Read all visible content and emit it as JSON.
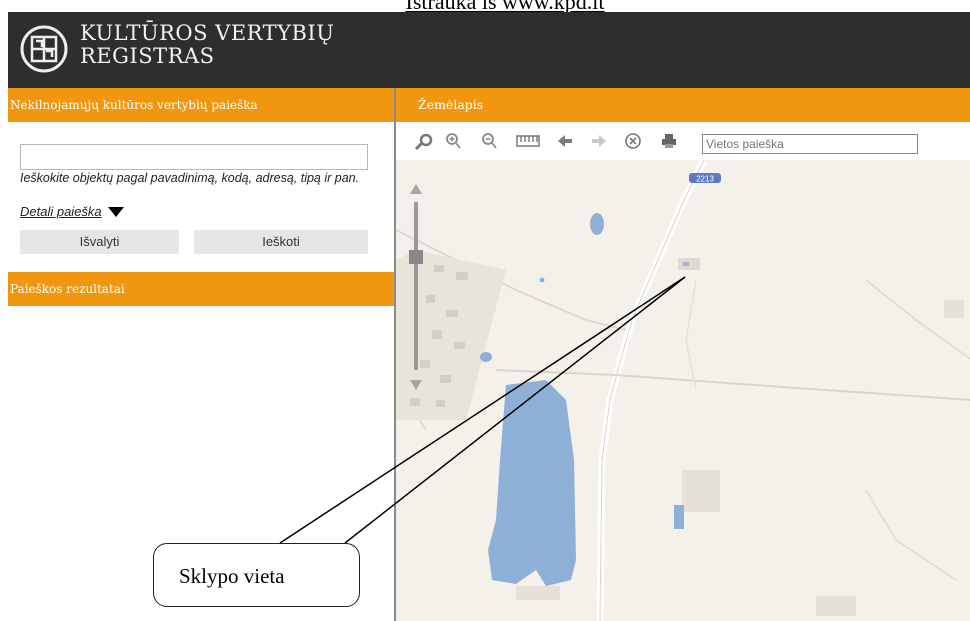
{
  "caption": "Ištrauka iš www.kpd.lt",
  "header": {
    "brand_line1": "KULTŪROS VERTYBIŲ",
    "brand_line2": "REGISTRAS",
    "logo_icon": "registry-logo-icon"
  },
  "left": {
    "search_title": "Nekilnojamųjų kultūros vertybių paieška",
    "search_input_value": "",
    "hint": "Ieškokite objektų pagal pavadinimą, kodą, adresą, tipą ir pan.",
    "detail_link": "Detali paieška",
    "clear_button": "Išvalyti",
    "search_button": "Ieškoti",
    "results_title": "Paieškos rezultatai"
  },
  "map": {
    "title": "Žemėlapis",
    "place_search_placeholder": "Vietos paieška",
    "road_badge": "2213",
    "toolbar_icons": [
      "pan-icon",
      "zoom-in-icon",
      "zoom-out-icon",
      "measure-icon",
      "back-icon",
      "forward-icon",
      "clear-icon",
      "print-icon"
    ]
  },
  "callout": {
    "label": "Sklypo vieta"
  },
  "colors": {
    "header_bg": "#2e2e2e",
    "accent_orange": "#f0960f",
    "map_bg": "#f4f1ea",
    "water": "#8fb0d6"
  }
}
